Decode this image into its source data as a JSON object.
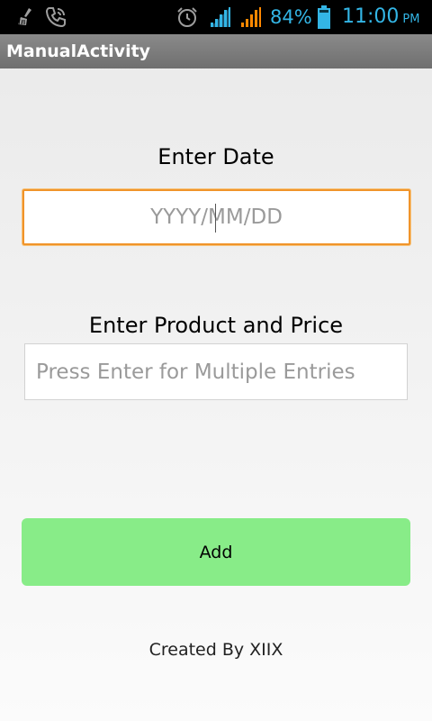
{
  "status_bar": {
    "icons": [
      "broom-icon",
      "call-icon",
      "alarm-icon",
      "signal-icon",
      "signal-icon",
      "battery-icon"
    ],
    "battery_text": "84%",
    "time": "11:00",
    "ampm": "PM",
    "accent_color": "#33b5e5",
    "signal_colors": [
      "#33b5e5",
      "#ff8800"
    ]
  },
  "title_bar": {
    "title": "ManualActivity"
  },
  "form": {
    "date_label": "Enter Date",
    "date_placeholder": "YYYY/MM/DD",
    "date_value": "",
    "product_label": "Enter Product and Price",
    "product_placeholder": "Press Enter for Multiple Entries",
    "product_value": "",
    "focus_color": "#f0942a"
  },
  "actions": {
    "add_label": "Add",
    "add_color": "#88ec88"
  },
  "footer": {
    "credit": "Created By XIIX"
  }
}
